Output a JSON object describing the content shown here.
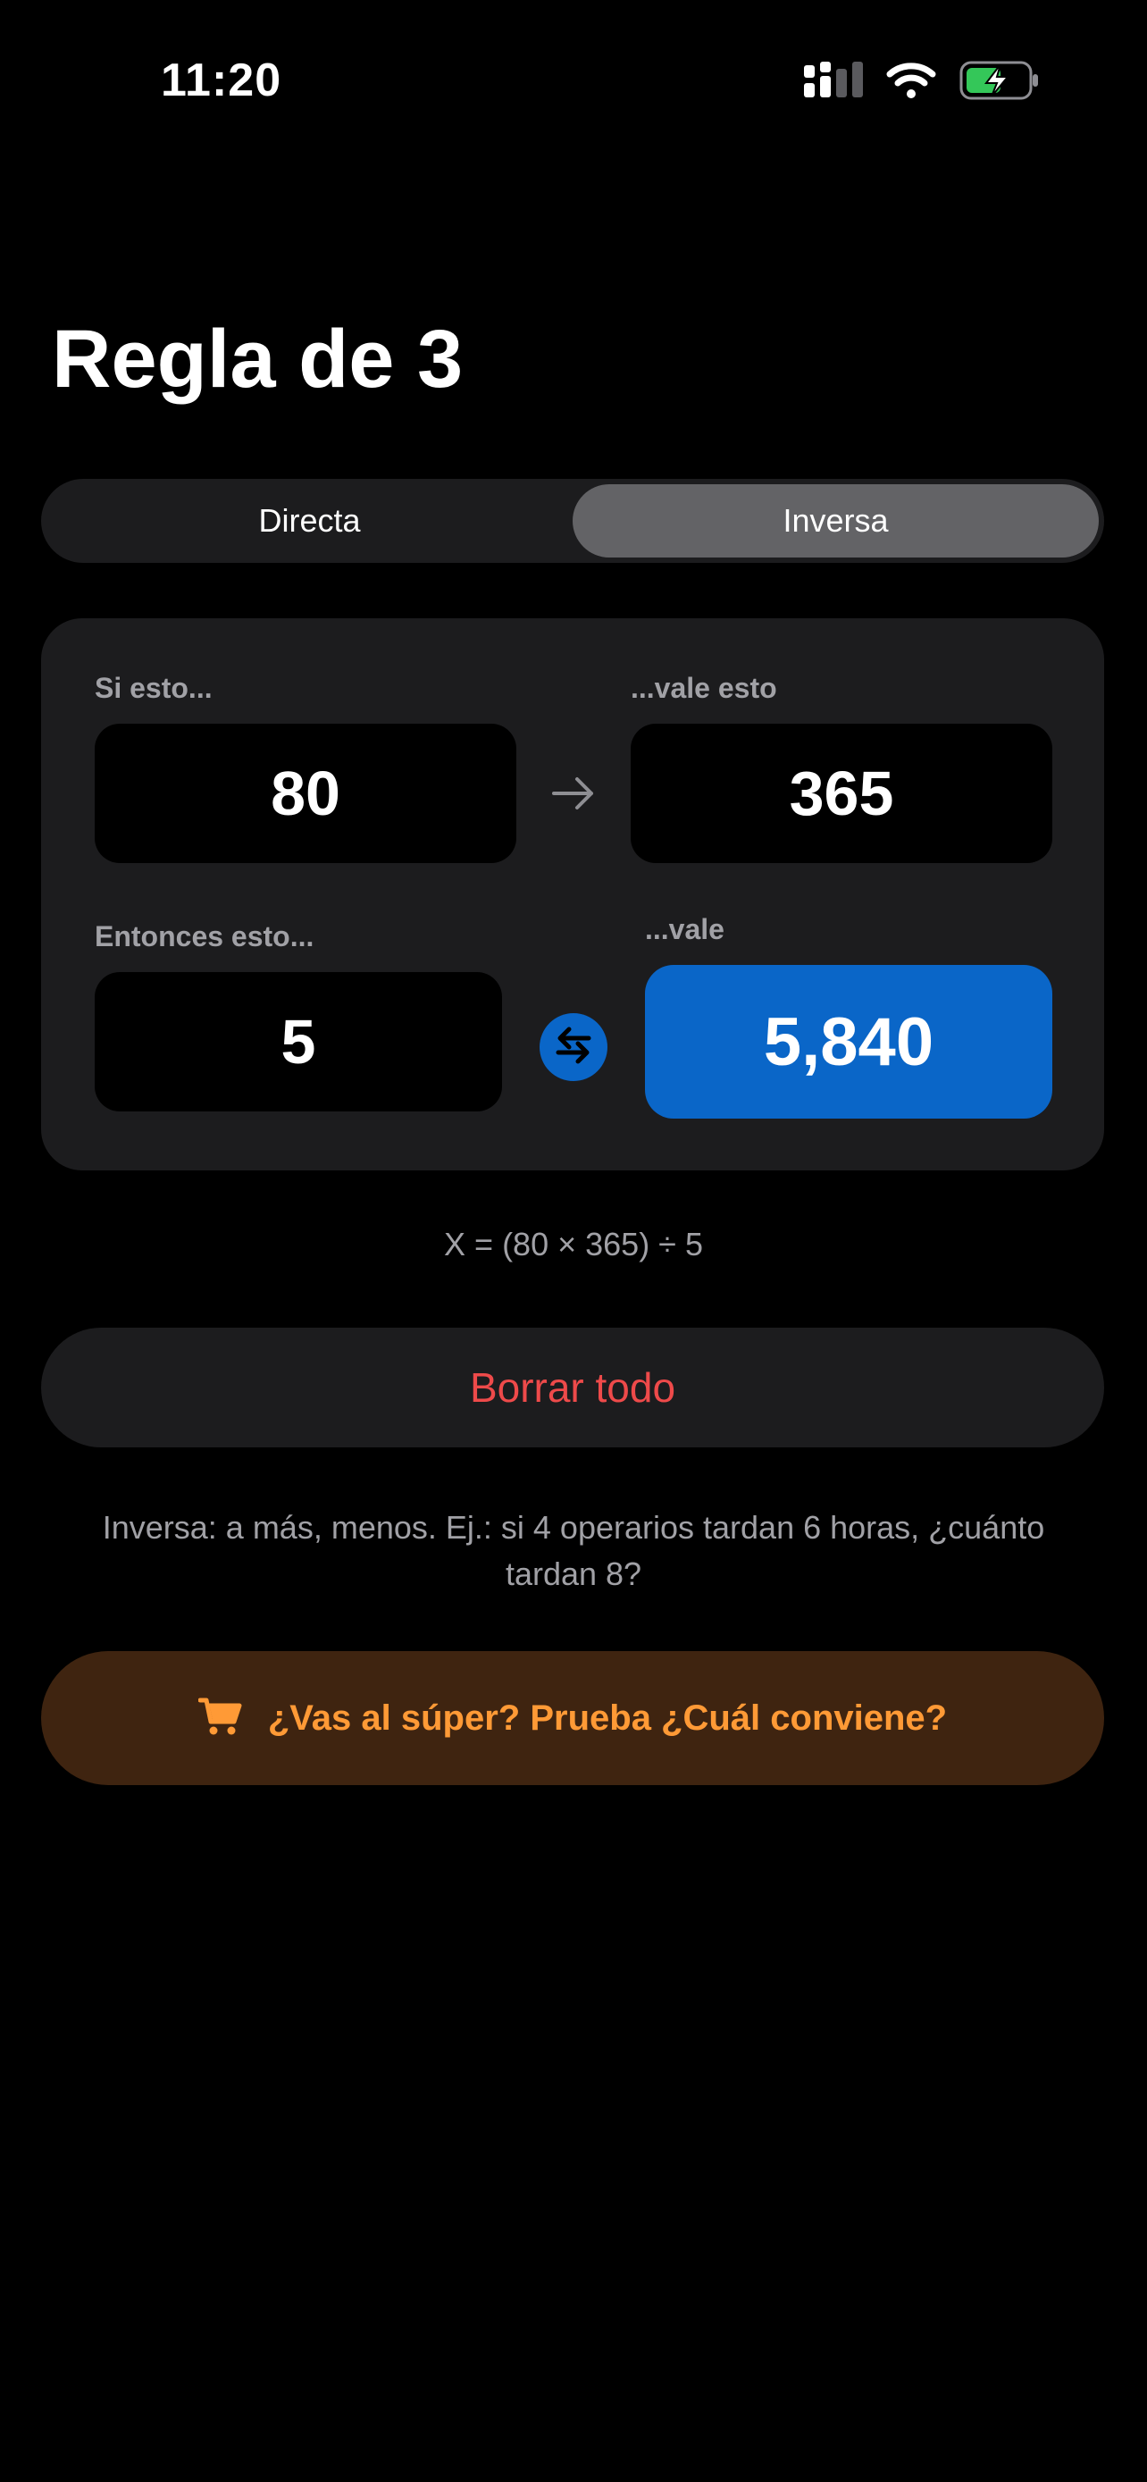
{
  "status": {
    "time": "11:20"
  },
  "title": "Regla de 3",
  "segments": [
    {
      "label": "Directa",
      "selected": false
    },
    {
      "label": "Inversa",
      "selected": true
    }
  ],
  "calculator": {
    "a_label": "Si esto...",
    "a_value": "80",
    "b_label": "...vale esto",
    "b_value": "365",
    "c_label": "Entonces esto...",
    "c_value": "5",
    "result_label": "...vale",
    "result_value": "5,840"
  },
  "formula": "X = (80 × 365) ÷ 5",
  "clear_label": "Borrar todo",
  "hint": "Inversa: a más, menos. Ej.: si 4 operarios tardan 6 horas, ¿cuánto tardan 8?",
  "promo_label": "¿Vas al súper? Prueba ¿Cuál conviene?",
  "colors": {
    "accent": "#0a66c8",
    "danger": "#ee4a4a",
    "promo_text": "#ff9a36",
    "promo_bg": "#3f2410",
    "battery": "#34c759"
  },
  "icons": [
    "signal-icon",
    "wifi-icon",
    "battery-charging-icon",
    "arrow-right-icon",
    "swap-icon",
    "cart-icon"
  ]
}
